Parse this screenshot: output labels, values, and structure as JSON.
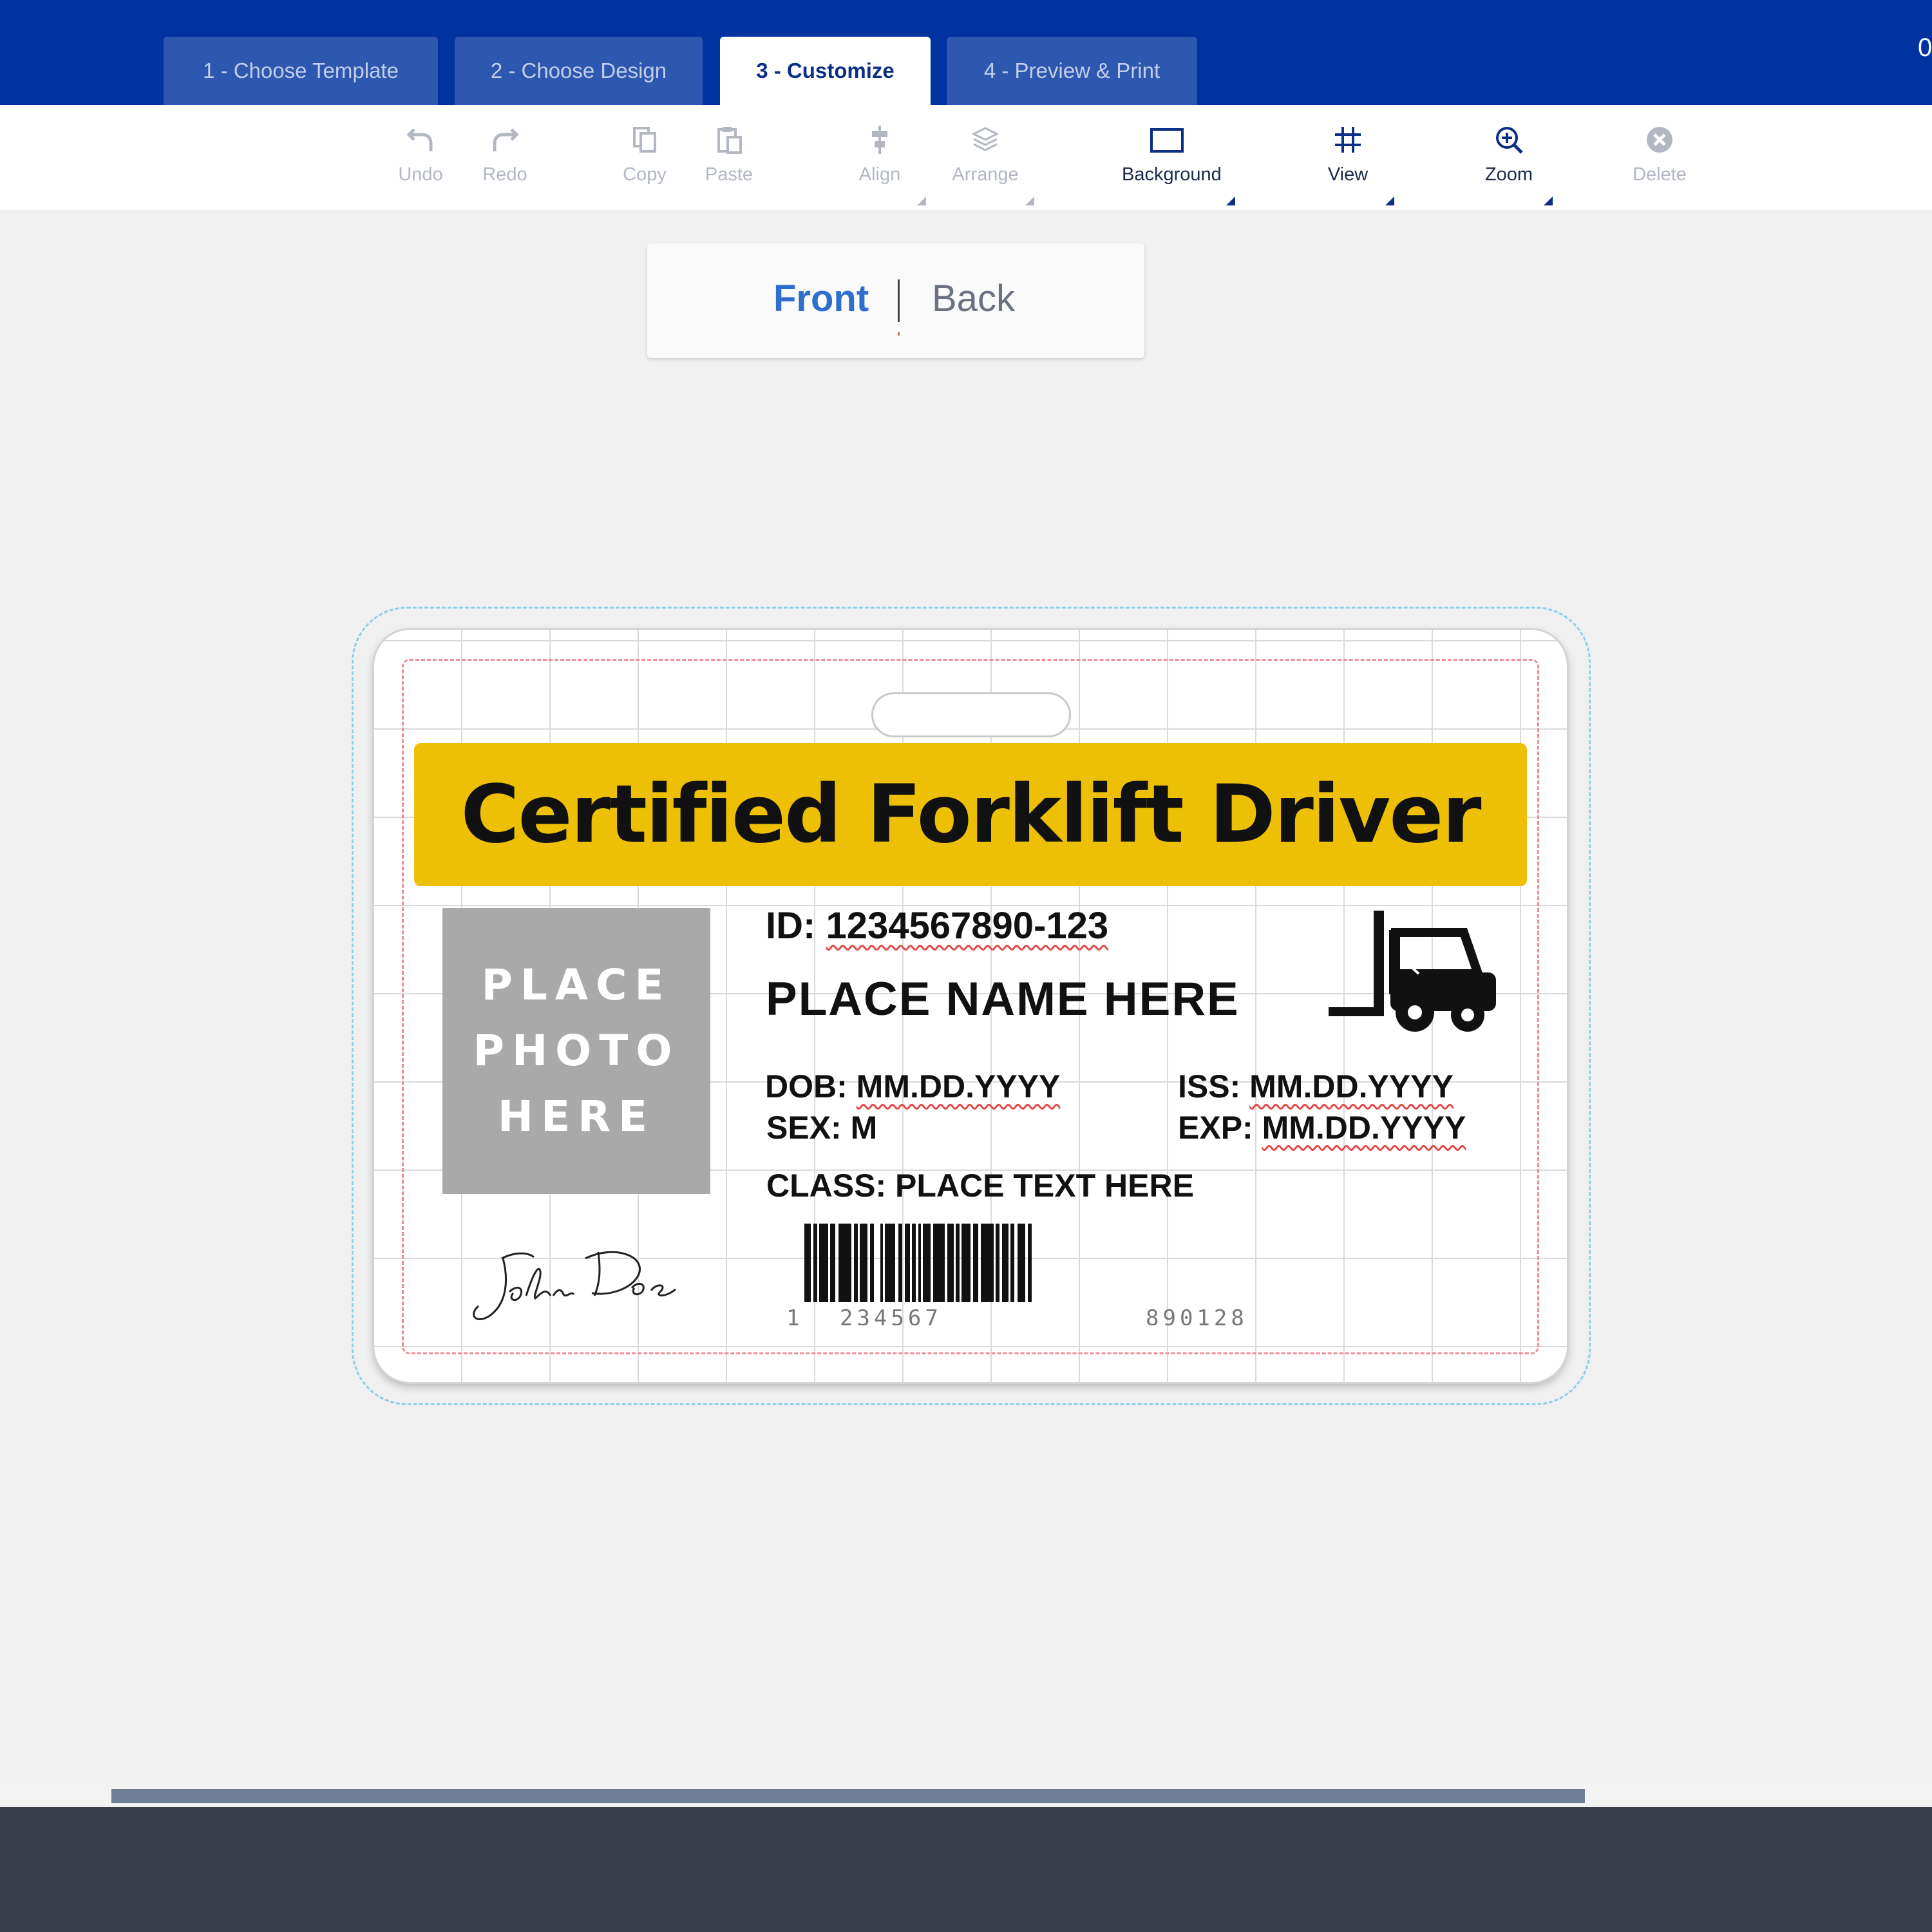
{
  "corner_text": "0",
  "tabs": [
    {
      "label": "1 - Choose Template",
      "active": false
    },
    {
      "label": "2 - Choose Design",
      "active": false
    },
    {
      "label": "3 - Customize",
      "active": true
    },
    {
      "label": "4 - Preview & Print",
      "active": false
    }
  ],
  "toolbar": {
    "undo": "Undo",
    "redo": "Redo",
    "copy": "Copy",
    "paste": "Paste",
    "align": "Align",
    "arrange": "Arrange",
    "background": "Background",
    "view": "View",
    "zoom": "Zoom",
    "delete": "Delete"
  },
  "side_switch": {
    "front": "Front",
    "back": "Back",
    "active": "Front"
  },
  "card": {
    "title": "Certified Forklift Driver",
    "photo_lines": [
      "PLACE",
      "PHOTO",
      "HERE"
    ],
    "id_label": "ID:",
    "id_value": "1234567890-123",
    "name": "PLACE NAME HERE",
    "dob_label": "DOB:",
    "dob_value": "MM.DD.YYYY",
    "iss_label": "ISS:",
    "iss_value": "MM.DD.YYYY",
    "sex_label": "SEX:",
    "sex_value": "M",
    "exp_label": "EXP:",
    "exp_value": "MM.DD.YYYY",
    "class_label": "CLASS:",
    "class_value": "PLACE TEXT HERE",
    "signature": "John Doe",
    "barcode_digits": [
      "1",
      "234567",
      "890128"
    ]
  },
  "colors": {
    "header": "#0033a0",
    "banner": "#edc005",
    "accent_front": "#2e6ecf",
    "footer": "#383d48"
  },
  "icons": [
    "undo-icon",
    "redo-icon",
    "copy-icon",
    "paste-icon",
    "align-icon",
    "arrange-icon",
    "background-icon",
    "grid-icon",
    "zoom-in-icon",
    "delete-icon",
    "forklift-icon"
  ]
}
